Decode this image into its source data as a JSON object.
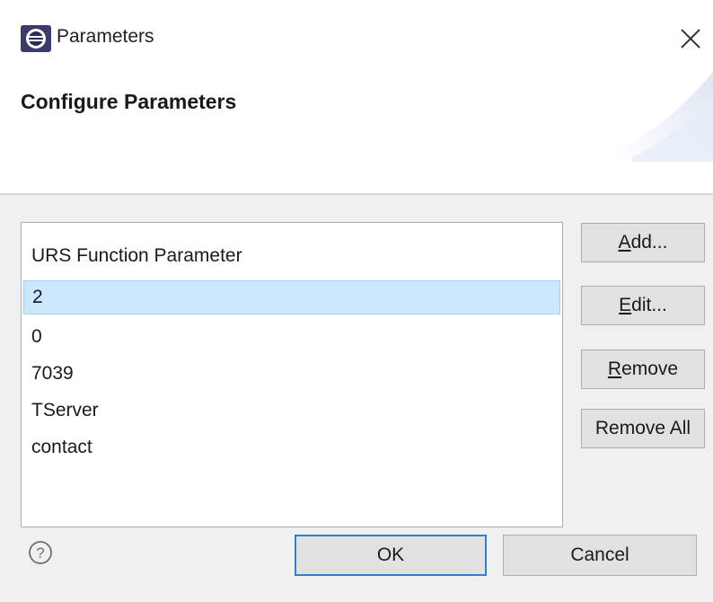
{
  "window": {
    "title": "Parameters",
    "app_icon": "eclipse-icon",
    "close_icon": "close-icon"
  },
  "banner": {
    "title": "Configure Parameters"
  },
  "list": {
    "items": [
      "URS Function Parameter",
      "2",
      "0",
      "7039",
      "TServer",
      "contact"
    ],
    "selected_index": 1
  },
  "buttons": {
    "add": {
      "mnemonic": "A",
      "rest": "dd..."
    },
    "edit": {
      "mnemonic": "E",
      "rest": "dit..."
    },
    "remove": {
      "mnemonic": "R",
      "rest": "emove"
    },
    "remove_all": "Remove All",
    "ok": "OK",
    "cancel": "Cancel"
  },
  "help": {
    "icon": "help-icon"
  },
  "colors": {
    "selection": "#cce8ff",
    "default_button_border": "#2f7fd3",
    "body_bg": "#f0f0f0"
  }
}
